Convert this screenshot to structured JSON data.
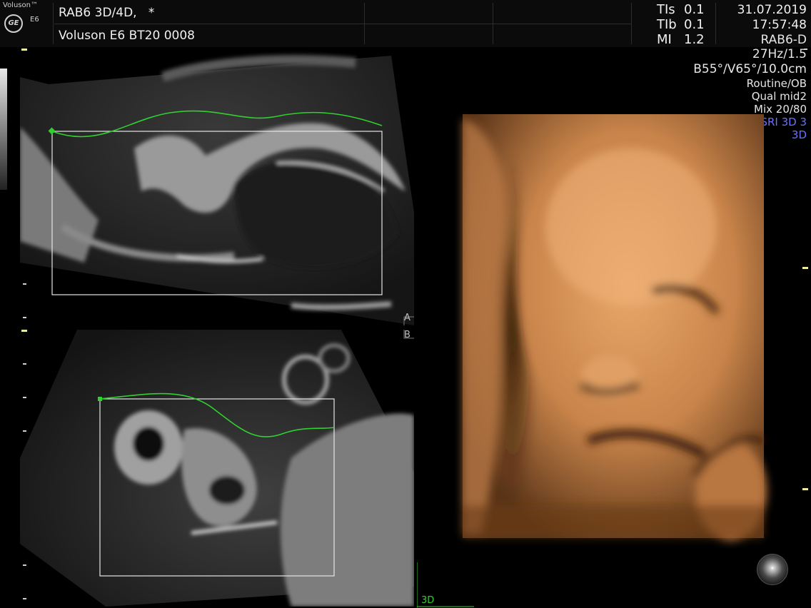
{
  "header": {
    "brand": "Voluson™",
    "logo_text": "GE",
    "model": "E6",
    "probe": "RAB6 3D/4D,",
    "probe_marker": "*",
    "patient": "Voluson E6 BT20 0008",
    "indices": [
      {
        "label": "TIs",
        "value": "0.1"
      },
      {
        "label": "TIb",
        "value": "0.1"
      },
      {
        "label": "MI",
        "value": "1.2"
      }
    ],
    "date": "31.07.2019",
    "time": "17:57:48"
  },
  "params": {
    "probe_mode": "RAB6-D",
    "frequency": "27Hz/1.5",
    "angles": "B55°/V65°/10.0cm",
    "program": "Routine/OB",
    "quality": "Qual mid2",
    "mix": "Mix 20/80",
    "sri": "SRI 3D 3",
    "mode": "3D"
  },
  "panels": {
    "a_label": "A",
    "b_label": "B",
    "render_label": "3D"
  },
  "colors": {
    "accent_green": "#30d030",
    "param_blue": "#6d70ff",
    "skin_tone": "#c8844a"
  }
}
